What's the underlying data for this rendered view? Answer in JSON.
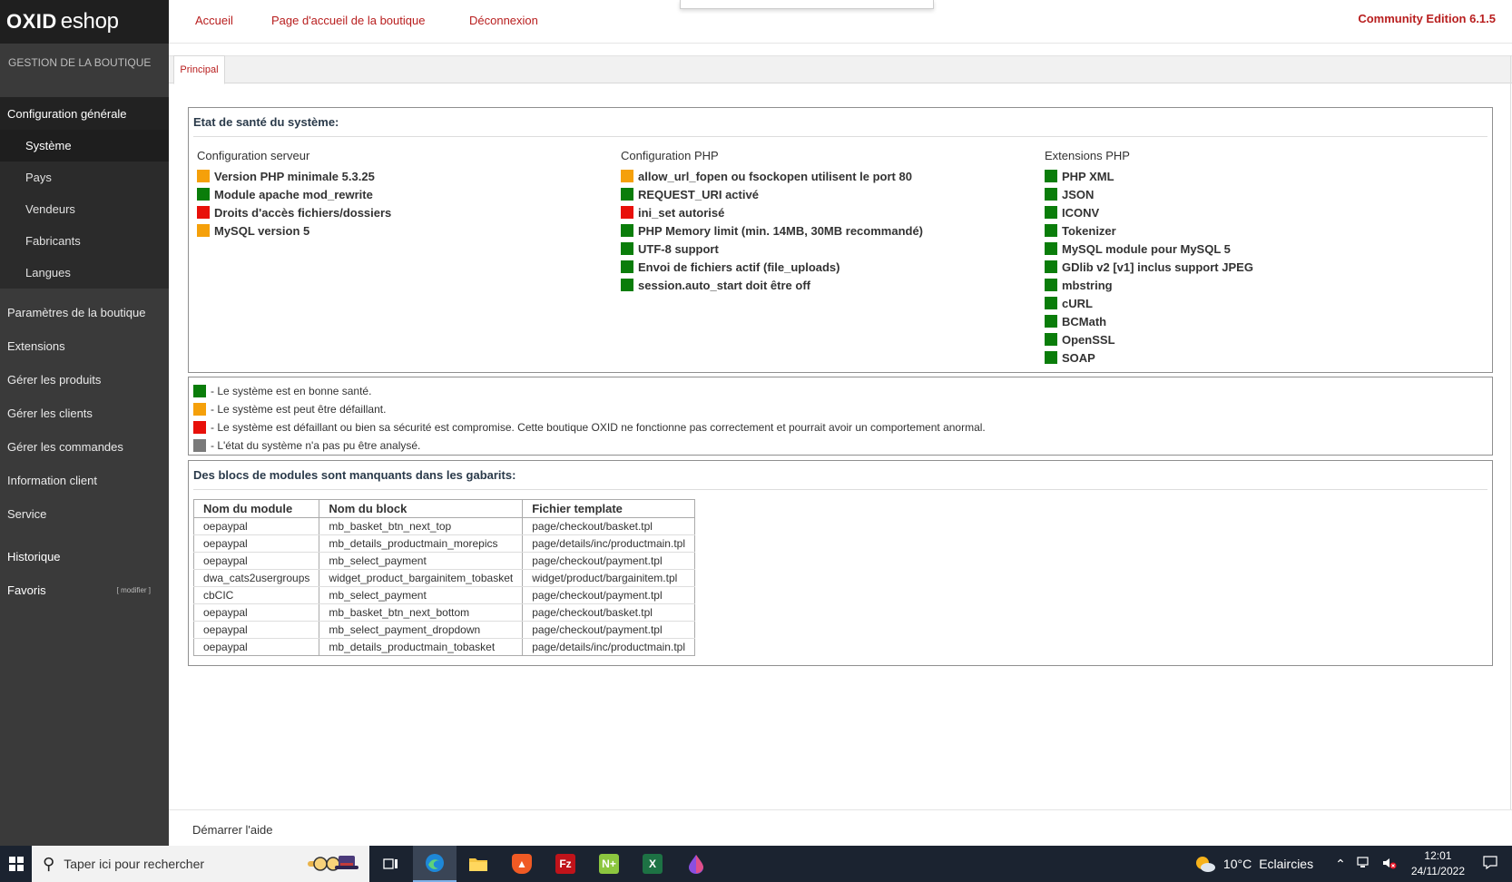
{
  "brand": {
    "logo_part1": "OXID",
    "logo_part2": "eshop",
    "edition": "Community Edition 6.1.5"
  },
  "top_nav": {
    "home": "Accueil",
    "shop_home": "Page d'accueil de la boutique",
    "logout": "Déconnexion"
  },
  "sidebar": {
    "section_title": "GESTION DE LA BOUTIQUE",
    "config_group": "Configuration générale",
    "config_items": [
      "Système",
      "Pays",
      "Vendeurs",
      "Fabricants",
      "Langues"
    ],
    "main_items": [
      "Paramètres de la boutique",
      "Extensions",
      "Gérer les produits",
      "Gérer les clients",
      "Gérer les commandes",
      "Information client",
      "Service"
    ],
    "history": "Historique",
    "favorites": "Favoris",
    "favorites_edit": "[ modifier ]"
  },
  "tabs": {
    "main": "Principal"
  },
  "health": {
    "title": "Etat de santé du système:",
    "server": {
      "heading": "Configuration serveur",
      "items": [
        {
          "label": "Version PHP minimale 5.3.25",
          "status": "orange"
        },
        {
          "label": "Module apache mod_rewrite",
          "status": "green"
        },
        {
          "label": "Droits d'accès fichiers/dossiers",
          "status": "red"
        },
        {
          "label": "MySQL version 5",
          "status": "orange"
        }
      ]
    },
    "php": {
      "heading": "Configuration PHP",
      "items": [
        {
          "label": "allow_url_fopen ou fsockopen utilisent le port 80",
          "status": "orange"
        },
        {
          "label": "REQUEST_URI activé",
          "status": "green"
        },
        {
          "label": "ini_set autorisé",
          "status": "red"
        },
        {
          "label": "PHP Memory limit (min. 14MB, 30MB recommandé)",
          "status": "green"
        },
        {
          "label": "UTF-8 support",
          "status": "green"
        },
        {
          "label": "Envoi de fichiers actif (file_uploads)",
          "status": "green"
        },
        {
          "label": "session.auto_start doit être off",
          "status": "green"
        }
      ]
    },
    "extensions": {
      "heading": "Extensions PHP",
      "items": [
        {
          "label": "PHP XML",
          "status": "green"
        },
        {
          "label": "JSON",
          "status": "green"
        },
        {
          "label": "ICONV",
          "status": "green"
        },
        {
          "label": "Tokenizer",
          "status": "green"
        },
        {
          "label": "MySQL module pour MySQL 5",
          "status": "green"
        },
        {
          "label": "GDlib v2 [v1] inclus support JPEG",
          "status": "green"
        },
        {
          "label": "mbstring",
          "status": "green"
        },
        {
          "label": "cURL",
          "status": "green"
        },
        {
          "label": "BCMath",
          "status": "green"
        },
        {
          "label": "OpenSSL",
          "status": "green"
        },
        {
          "label": "SOAP",
          "status": "green"
        }
      ]
    }
  },
  "legend": [
    {
      "status": "green",
      "text": "- Le système est en bonne santé."
    },
    {
      "status": "orange",
      "text": "- Le système est peut être défaillant."
    },
    {
      "status": "red",
      "text": "- Le système est défaillant ou bien sa sécurité est compromise. Cette boutique OXID ne fonctionne pas correctement et pourrait avoir un comportement anormal."
    },
    {
      "status": "gray",
      "text": "- L'état du système n'a pas pu être analysé."
    }
  ],
  "status_colors": {
    "green": "#0a7d0a",
    "orange": "#f5a00a",
    "red": "#e8100a",
    "gray": "#7a7a7a"
  },
  "modules": {
    "title": "Des blocs de modules sont manquants dans les gabarits:",
    "headers": [
      "Nom du module",
      "Nom du block",
      "Fichier template"
    ],
    "rows": [
      [
        "oepaypal",
        "mb_basket_btn_next_top",
        "page/checkout/basket.tpl"
      ],
      [
        "oepaypal",
        "mb_details_productmain_morepics",
        "page/details/inc/productmain.tpl"
      ],
      [
        "oepaypal",
        "mb_select_payment",
        "page/checkout/payment.tpl"
      ],
      [
        "dwa_cats2usergroups",
        "widget_product_bargainitem_tobasket",
        "widget/product/bargainitem.tpl"
      ],
      [
        "cbCIC",
        "mb_select_payment",
        "page/checkout/payment.tpl"
      ],
      [
        "oepaypal",
        "mb_basket_btn_next_bottom",
        "page/checkout/basket.tpl"
      ],
      [
        "oepaypal",
        "mb_select_payment_dropdown",
        "page/checkout/payment.tpl"
      ],
      [
        "oepaypal",
        "mb_details_productmain_tobasket",
        "page/details/inc/productmain.tpl"
      ]
    ]
  },
  "help": {
    "start": "Démarrer l'aide"
  },
  "taskbar": {
    "search_placeholder": "Taper ici pour rechercher",
    "weather_temp": "10°C",
    "weather_text": "Eclaircies",
    "time": "12:01",
    "date": "24/11/2022",
    "apps": [
      "task-view-icon",
      "edge-icon",
      "file-explorer-icon",
      "brave-icon",
      "filezilla-icon",
      "notepad-plus-icon",
      "excel-icon",
      "paint-icon"
    ]
  }
}
